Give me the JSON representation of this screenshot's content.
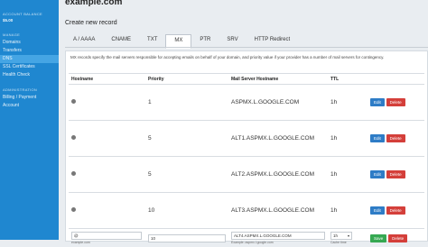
{
  "sidebar": {
    "account_balance_label": "ACCOUNT BALANCE",
    "account_balance_value": "$5.00",
    "manage_label": "MANAGE",
    "manage_items": [
      "Domains",
      "Transfers",
      "DNS",
      "SSL Certificates",
      "Health Check"
    ],
    "active_item": "DNS",
    "administration_label": "ADMINISTRATION",
    "admin_items": [
      "Billing / Payment",
      "Account"
    ]
  },
  "page": {
    "title": "example.com",
    "section_title": "Create new record"
  },
  "tabs": [
    "A / AAAA",
    "CNAME",
    "TXT",
    "MX",
    "PTR",
    "SRV",
    "HTTP Redirect"
  ],
  "active_tab": "MX",
  "description": "MX records specify the mail servers responsible for accepting emails on behalf of your domain, and priority value if your provider has a number of mail servers for contingency.",
  "table": {
    "headers": [
      "Hostname",
      "Priority",
      "Mail Server Hostname",
      "TTL"
    ],
    "rows": [
      {
        "priority": "1",
        "mail_server": "ASPMX.L.GOOGLE.COM",
        "ttl": "1h"
      },
      {
        "priority": "5",
        "mail_server": "ALT1.ASPMX.L.GOOGLE.COM",
        "ttl": "1h"
      },
      {
        "priority": "5",
        "mail_server": "ALT2.ASPMX.L.GOOGLE.COM",
        "ttl": "1h"
      },
      {
        "priority": "10",
        "mail_server": "ALT3.ASPMX.L.GOOGLE.COM",
        "ttl": "1h"
      }
    ],
    "edit_label": "Edit",
    "delete_label": "Delete"
  },
  "form": {
    "hostname_value": "@",
    "hostname_hint": "example.com",
    "priority_value": "10",
    "mail_server_value": "ALT4.ASPMX.L.GOOGLE.COM",
    "mail_server_hint": "Example: aspmx.l.google.com",
    "ttl_value": "1h",
    "ttl_hint": "Cache time",
    "save_label": "Save",
    "delete_label": "Delete"
  }
}
